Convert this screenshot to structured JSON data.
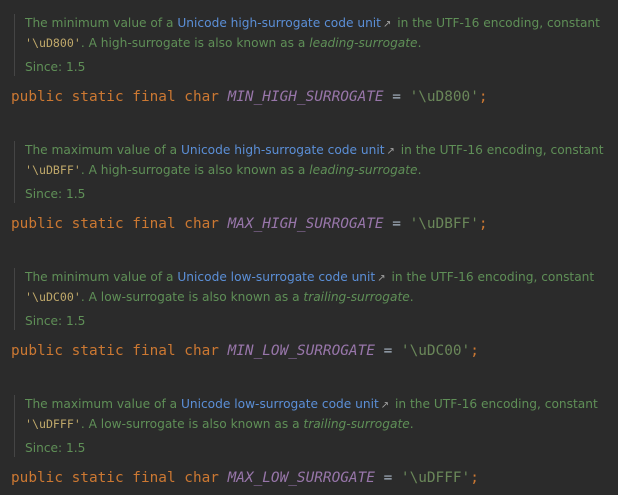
{
  "docs": [
    {
      "pre": "The minimum value of a ",
      "link": "Unicode high-surrogate code unit",
      "post": " in the UTF-16 encoding, constant",
      "code": "'\\uD800'",
      "mid": ". A high-surrogate is also known as a ",
      "term": "leading-surrogate",
      "end": ".",
      "since": "Since: 1.5",
      "decl_kw": "public static final char",
      "decl_name": "MIN_HIGH_SURROGATE",
      "decl_eq": " = ",
      "decl_val": "'\\uD800'",
      "decl_semi": ";"
    },
    {
      "pre": "The maximum value of a ",
      "link": "Unicode high-surrogate code unit",
      "post": " in the UTF-16 encoding, constant",
      "code": "'\\uDBFF'",
      "mid": ". A high-surrogate is also known as a ",
      "term": "leading-surrogate",
      "end": ".",
      "since": "Since: 1.5",
      "decl_kw": "public static final char",
      "decl_name": "MAX_HIGH_SURROGATE",
      "decl_eq": " = ",
      "decl_val": "'\\uDBFF'",
      "decl_semi": ";"
    },
    {
      "pre": "The minimum value of a ",
      "link": "Unicode low-surrogate code unit",
      "post": " in the UTF-16 encoding, constant",
      "code": "'\\uDC00'",
      "mid": ". A low-surrogate is also known as a ",
      "term": "trailing-surrogate",
      "end": ".",
      "since": "Since: 1.5",
      "decl_kw": "public static final char",
      "decl_name": "MIN_LOW_SURROGATE",
      "decl_eq": " = ",
      "decl_val": "'\\uDC00'",
      "decl_semi": ";"
    },
    {
      "pre": "The maximum value of a ",
      "link": "Unicode low-surrogate code unit",
      "post": " in the UTF-16 encoding, constant",
      "code": "'\\uDFFF'",
      "mid": ". A low-surrogate is also known as a ",
      "term": "trailing-surrogate",
      "end": ".",
      "since": "Since: 1.5",
      "decl_kw": "public static final char",
      "decl_name": "MAX_LOW_SURROGATE",
      "decl_eq": " = ",
      "decl_val": "'\\uDFFF'",
      "decl_semi": ";"
    }
  ],
  "icons": {
    "external_link": "↗"
  },
  "colors": {
    "background": "#2b2b2b",
    "doc_text": "#5f8f57",
    "link": "#5b8fd7",
    "keyword": "#cc7832",
    "field": "#9876aa",
    "string": "#6a8759"
  }
}
